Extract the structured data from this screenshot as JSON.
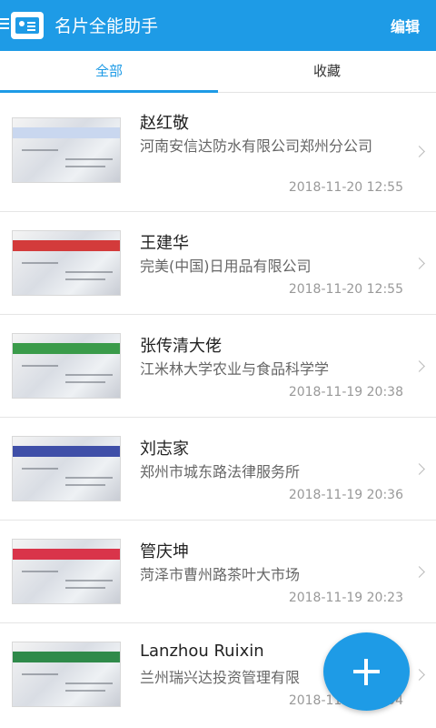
{
  "app": {
    "title": "名片全能助手",
    "edit_label": "编辑"
  },
  "tabs": [
    {
      "label": "全部"
    },
    {
      "label": "收藏"
    }
  ],
  "cards": [
    {
      "name": "赵红敬",
      "company": "河南安信达防水有限公司郑州分公司",
      "time": "2018-11-20 12:55",
      "band_color": "#c9d7ef"
    },
    {
      "name": "王建华",
      "company": "完美(中国)日用品有限公司",
      "time": "2018-11-20 12:55",
      "band_color": "#d33b3b"
    },
    {
      "name": "张传清大佬",
      "company": "江米林大学农业与食品科学学",
      "time": "2018-11-19 20:38",
      "band_color": "#3a9b4a"
    },
    {
      "name": "刘志家",
      "company": "郑州市城东路法律服务所",
      "time": "2018-11-19 20:36",
      "band_color": "#3f4fa8"
    },
    {
      "name": "管庆坤",
      "company": "菏泽市曹州路茶叶大市场",
      "time": "2018-11-19 20:23",
      "band_color": "#d9344a"
    },
    {
      "name": "Lanzhou Ruixin",
      "company": "兰州瑞兴达投资管理有限",
      "time": "2018-11-19 20:04",
      "band_color": "#2f8a4a"
    }
  ],
  "fab": {
    "icon": "plus-icon"
  },
  "colors": {
    "primary": "#1e9be6"
  }
}
